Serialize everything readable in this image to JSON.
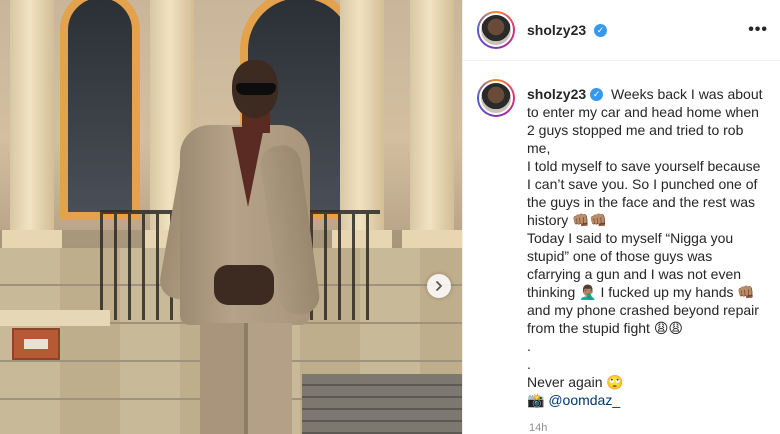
{
  "post": {
    "username": "sholzy23",
    "verified": true,
    "more_label": "•••",
    "next_label": "›"
  },
  "caption": {
    "username": "sholzy23",
    "lines": [
      "Weeks back I was about to enter my car and head home when 2 guys stopped me and tried to rob me,",
      "I told myself to save yourself because I can’t save you. So I punched one of the guys in the face and the rest was history 👊🏽👊🏽",
      "Today I said to myself “Nigga you stupid” one of those guys was cfarrying a gun and I was not even thinking 🤦🏽‍♂️ I fucked up my hands 👊🏽 and my phone crashed beyond repair from the stupid fight 😩😩",
      ".",
      ".",
      "Never again 🙄"
    ],
    "credit_icon": "📸",
    "credit_handle": "@oomdaz_",
    "timestamp": "14h"
  },
  "colors": {
    "verified_blue": "#3897f0",
    "text": "#262626",
    "mention": "#00376b"
  }
}
